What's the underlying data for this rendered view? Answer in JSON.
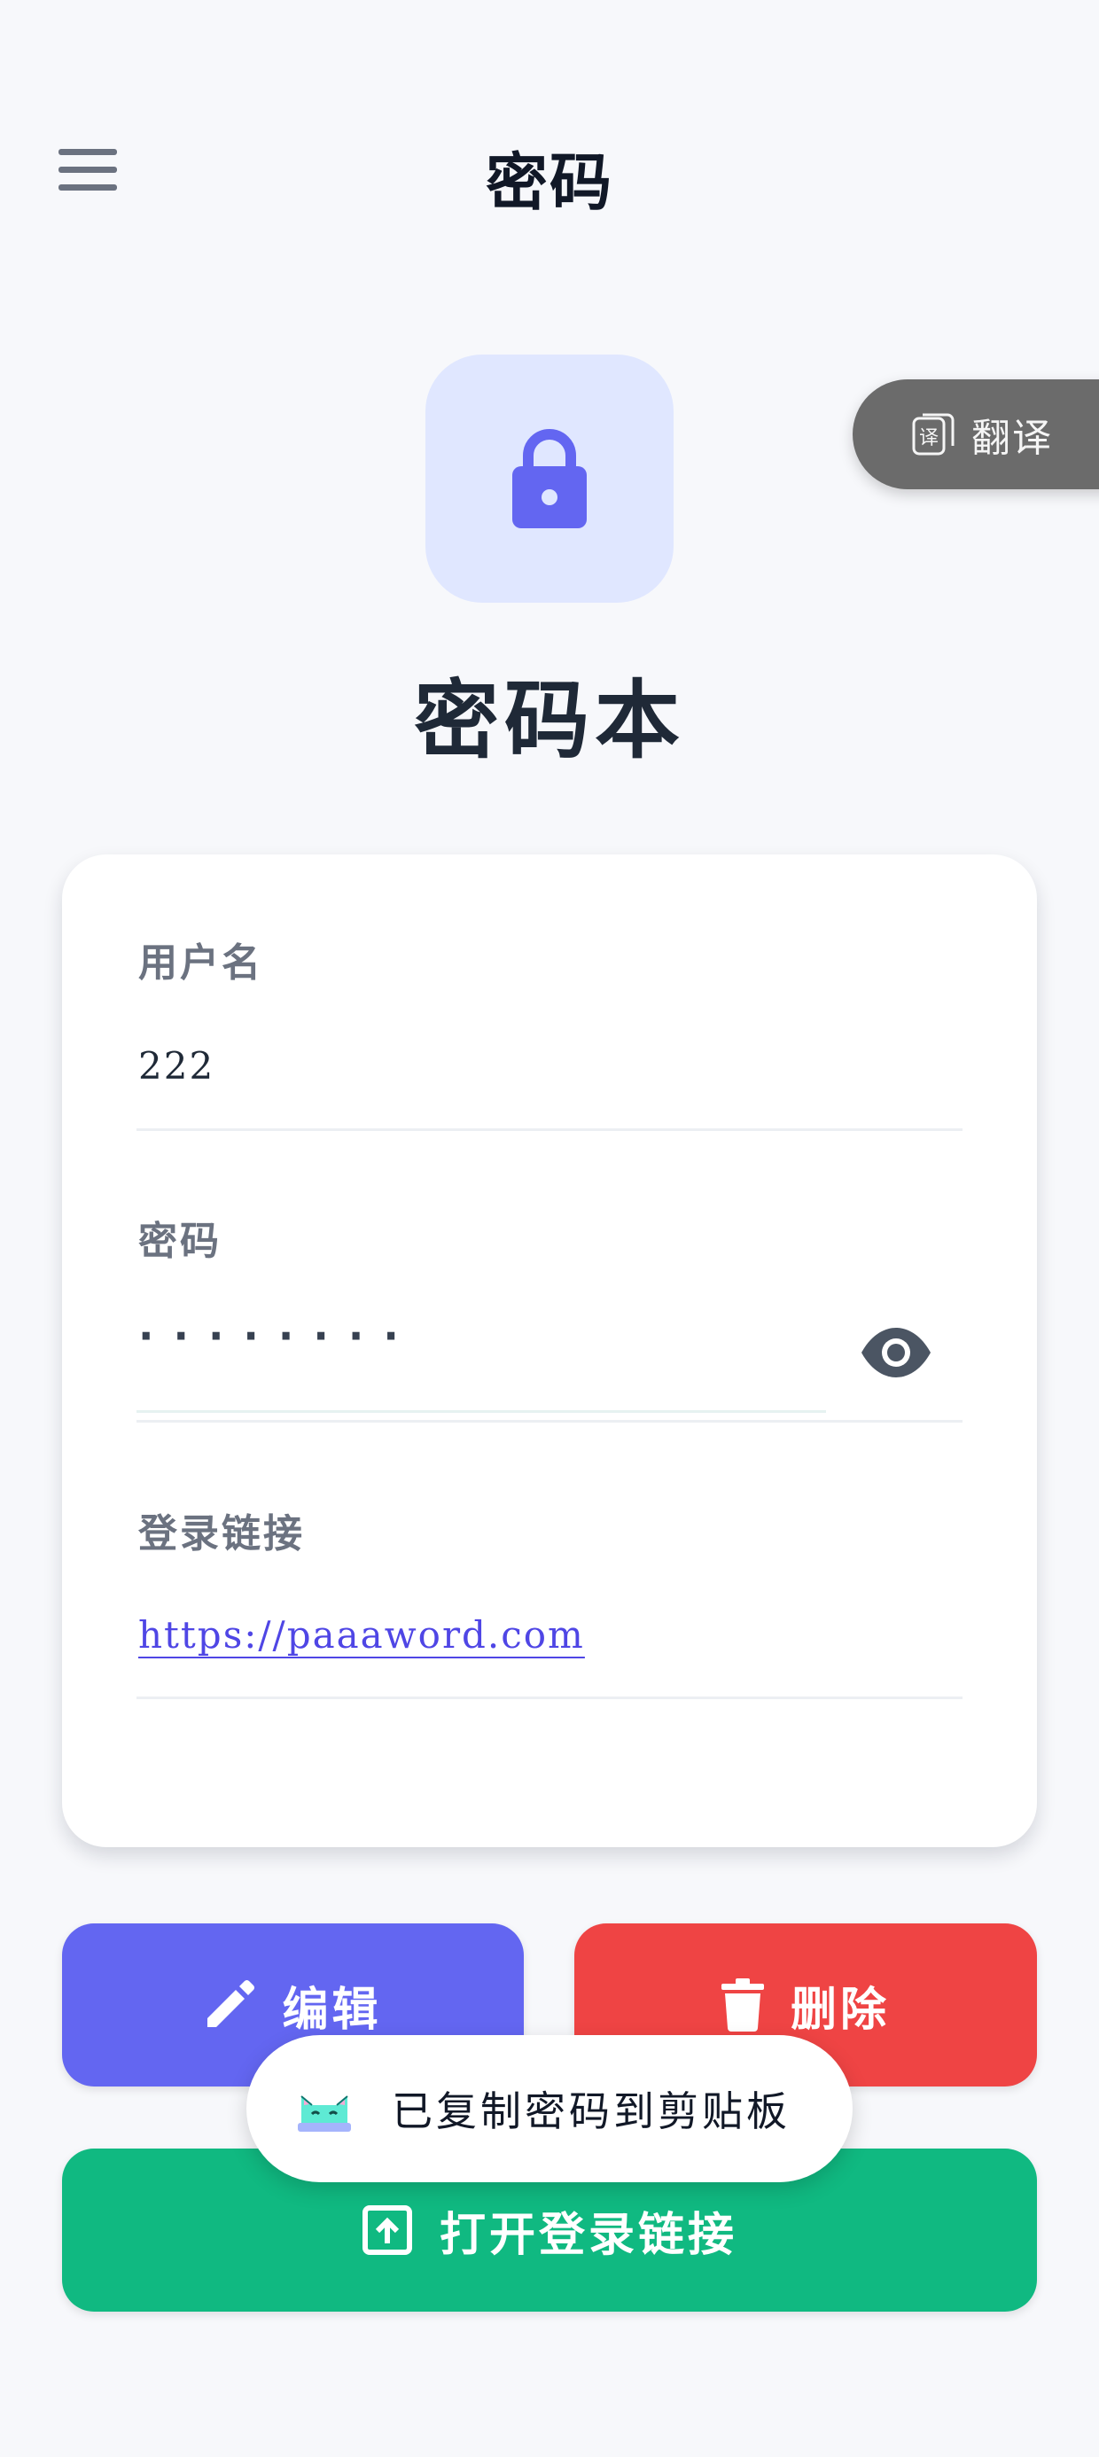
{
  "header": {
    "title": "密码"
  },
  "translate": {
    "label": "翻译",
    "icon": "translate-icon"
  },
  "app": {
    "name": "密码本",
    "icon": "lock-icon"
  },
  "fields": {
    "username": {
      "label": "用户名",
      "value": "222"
    },
    "password": {
      "label": "密码",
      "masked_value": "········"
    },
    "login_link": {
      "label": "登录链接",
      "value": "https://paaaword.com"
    }
  },
  "buttons": {
    "edit": "编辑",
    "delete": "删除",
    "open_link": "打开登录链接"
  },
  "toast": {
    "message": "已复制密码到剪贴板",
    "icon": "cat-icon"
  },
  "colors": {
    "background": "#f7f8fb",
    "accent": "#6366f1",
    "danger": "#ef4444",
    "success": "#10b981",
    "icon_tile": "#e0e7ff"
  }
}
